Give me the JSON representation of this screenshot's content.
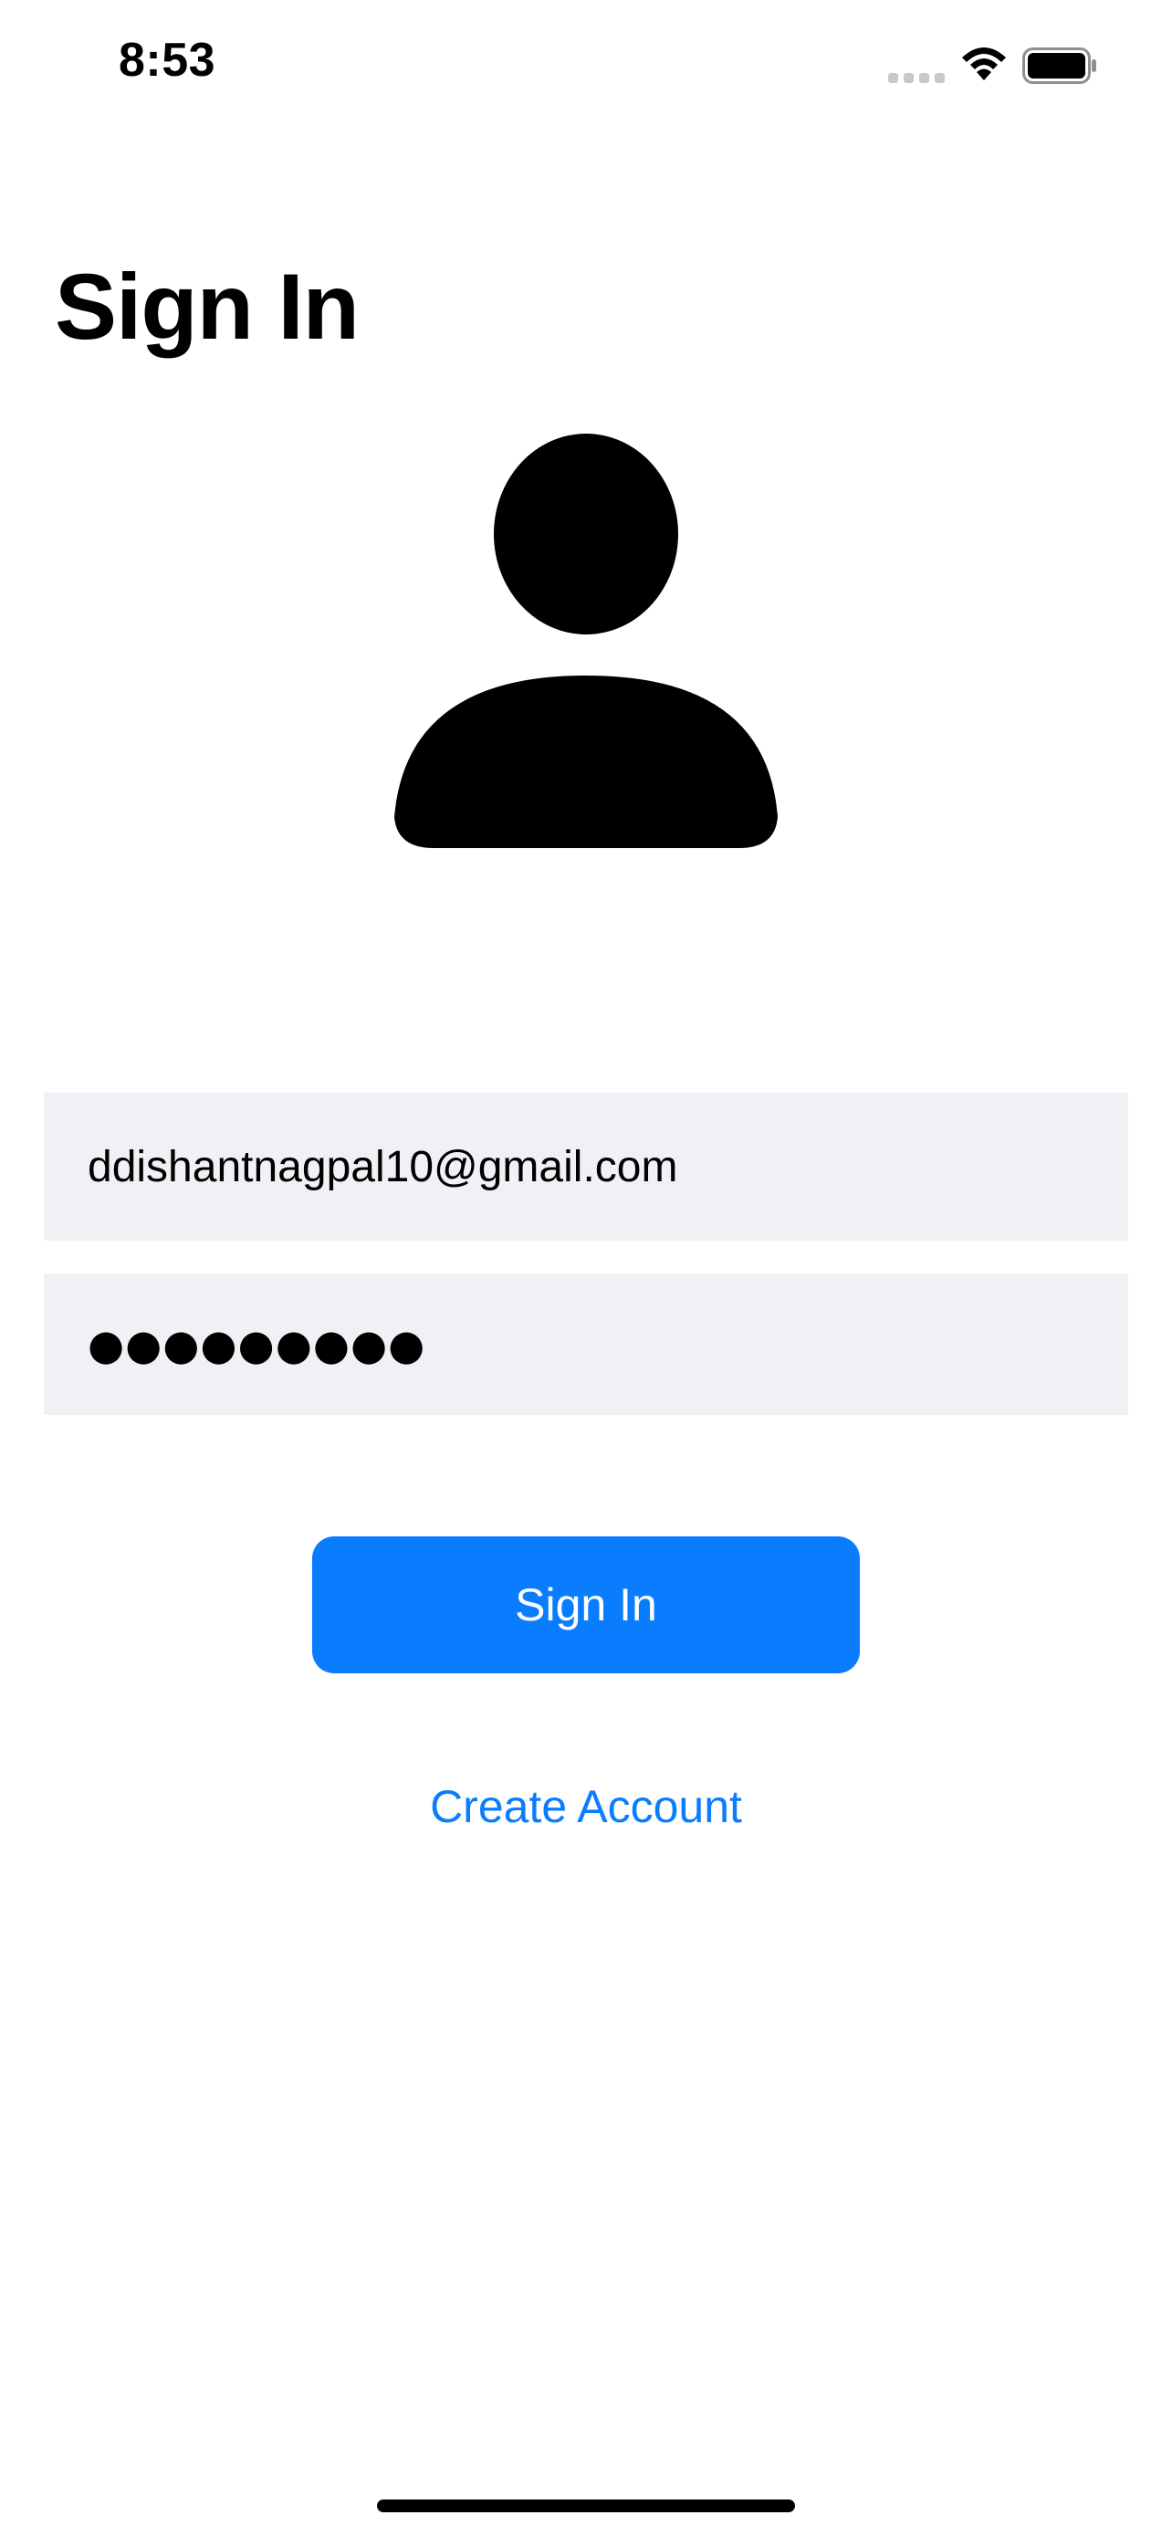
{
  "status_bar": {
    "time": "8:53",
    "icons": [
      "cellular-signal-icon",
      "wifi-icon",
      "battery-icon"
    ]
  },
  "page": {
    "title": "Sign In",
    "avatar_icon": "person-icon"
  },
  "form": {
    "email_value": "ddishantnagpal10@gmail.com",
    "password_masked": "●●●●●●●●●",
    "sign_in_label": "Sign In",
    "create_account_label": "Create Account"
  },
  "colors": {
    "accent": "#0a7dff",
    "field_background": "#f1f1f5"
  }
}
